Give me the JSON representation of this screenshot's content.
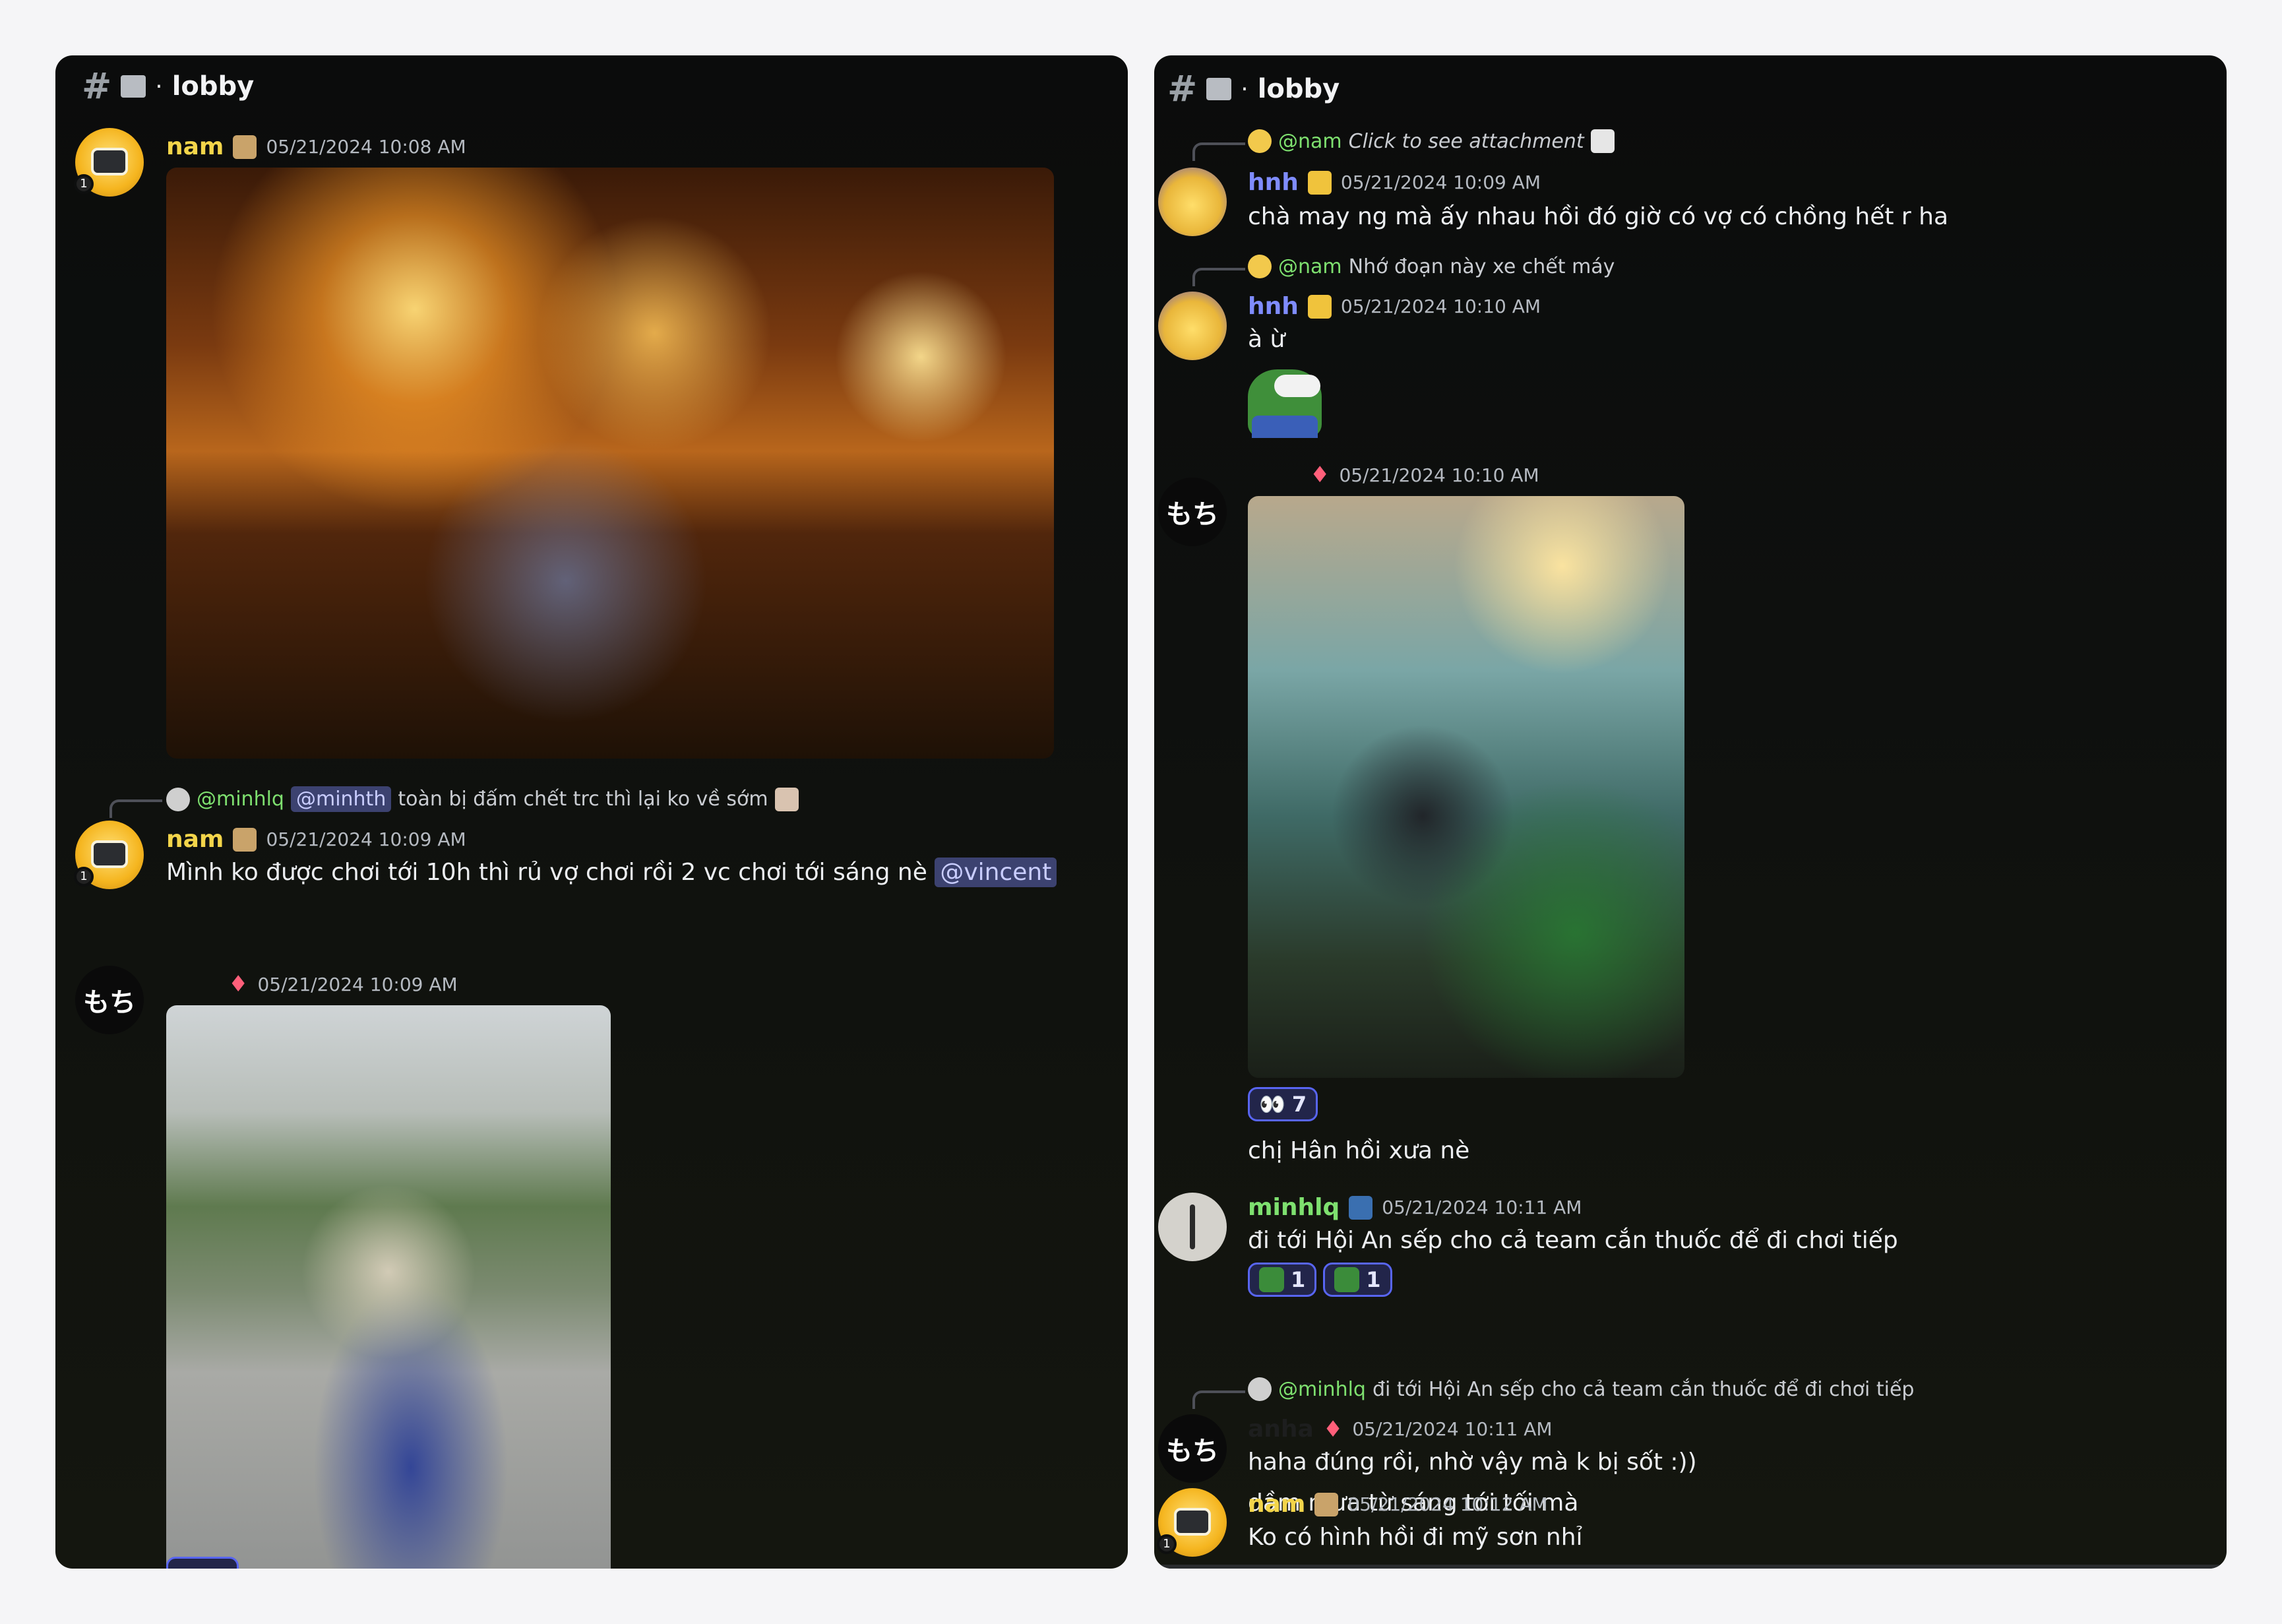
{
  "colors": {
    "nam": "#f3d54a",
    "hnh": "#7f8cff",
    "minhlq": "#7ee06f",
    "reaction_border": "#5865f2"
  },
  "left": {
    "header": {
      "hash": "#",
      "dot": "·",
      "title": "lobby"
    },
    "m1": {
      "author": "nam",
      "ts": "05/21/2024 10:08 AM"
    },
    "m2": {
      "reply_author": "@minhlq",
      "reply_mention": "@minhth",
      "reply_text": "toàn bị đấm chết trc thì lại ko về sớm",
      "author": "nam",
      "ts": "05/21/2024 10:09 AM",
      "text": "Mình ko được chơi tới 10h thì rủ vợ chơi rồi 2 vc chơi tới sáng nè",
      "mention": "@vincent"
    },
    "m3": {
      "avatar_text": "もち",
      "ts": "05/21/2024 10:09 AM"
    }
  },
  "right": {
    "header": {
      "hash": "#",
      "dot": "·",
      "title": "lobby"
    },
    "m1": {
      "reply_author": "@nam",
      "reply_text": "Click to see attachment",
      "author": "hnh",
      "ts": "05/21/2024 10:09 AM",
      "text": "chà may ng mà ấy nhau hồi đó giờ có vợ có chồng hết r ha"
    },
    "m2": {
      "reply_author": "@nam",
      "reply_text": "Nhớ đoạn này xe chết máy",
      "author": "hnh",
      "ts": "05/21/2024 10:10 AM",
      "text": "à ừ"
    },
    "m3": {
      "avatar_text": "もち",
      "ts": "05/21/2024 10:10 AM",
      "reaction": {
        "icon": "👀",
        "count": "7"
      },
      "text": "chị Hân hồi xưa nè"
    },
    "m4": {
      "author": "minhlq",
      "ts": "05/21/2024 10:11 AM",
      "text": "đi tới Hội An sếp cho cả team cắn thuốc để đi chơi tiếp",
      "reactions": [
        {
          "count": "1"
        },
        {
          "count": "1"
        }
      ]
    },
    "m5": {
      "reply_author": "@minhlq",
      "reply_text": "đi tới Hội An sếp cho cả team cắn thuốc để đi chơi tiếp",
      "avatar_text": "もち",
      "author_hidden": "anha",
      "ts": "05/21/2024 10:11 AM",
      "text1": "haha đúng rồi, nhờ vậy mà k bị sốt :))",
      "text2": "dầm mưa từ sáng tới tối mà"
    },
    "m6": {
      "author": "nam",
      "ts": "05/21/2024 10:12 AM",
      "text": "Ko có hình hồi đi mỹ sơn nhỉ"
    }
  }
}
